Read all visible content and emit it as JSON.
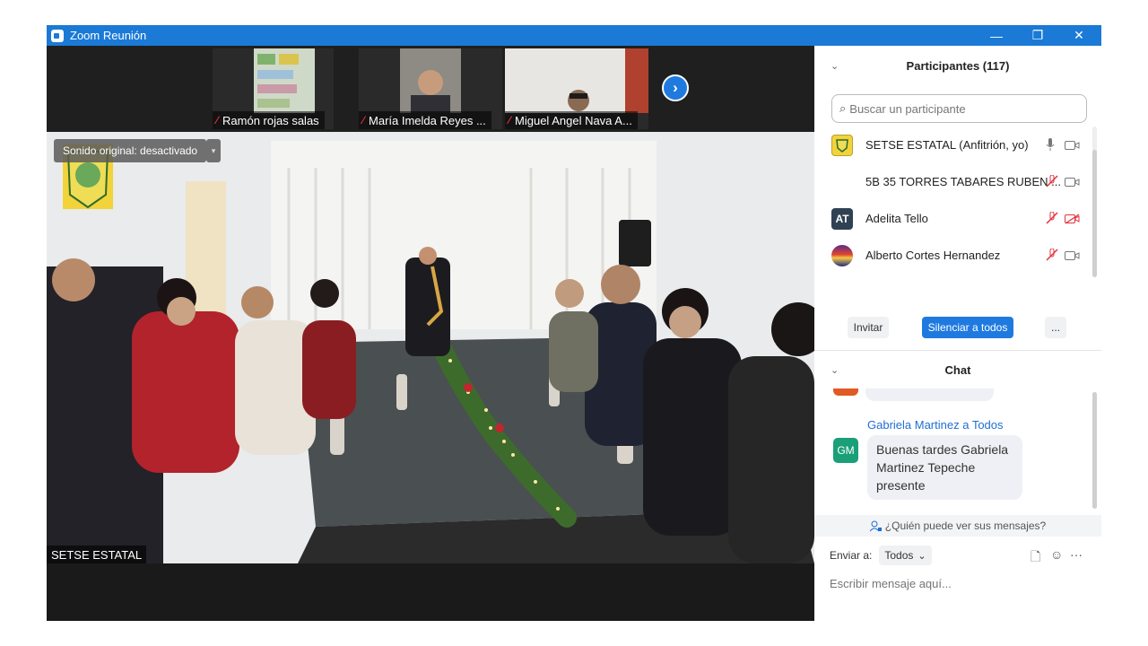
{
  "window": {
    "title": "Zoom Reunión",
    "minimize": "—",
    "restore": "❐",
    "close": "✕"
  },
  "strip": {
    "thumbs": [
      {
        "name": "Ramón rojas salas"
      },
      {
        "name": "María Imelda Reyes ..."
      },
      {
        "name": "Miguel Angel Nava A..."
      }
    ],
    "next": "›"
  },
  "main_video": {
    "sound_label": "Sonido original: desactivado",
    "sound_arrow": "▾",
    "speaker": "SETSE ESTATAL"
  },
  "participants": {
    "title": "Participantes (117)",
    "collapse": "⌄",
    "search_placeholder": "Buscar un participante",
    "rows": [
      {
        "name": "SETSE ESTATAL (Anfitrión, yo)",
        "avatar": "",
        "mic": "on",
        "cam": "on"
      },
      {
        "name": "5B 35 TORRES TABARES RUBEN ...",
        "avatar": "",
        "mic": "off",
        "cam": "on"
      },
      {
        "name": "Adelita Tello",
        "avatar": "AT",
        "mic": "off",
        "cam": "off"
      },
      {
        "name": "Alberto Cortes Hernandez",
        "avatar": "",
        "mic": "off",
        "cam": "on"
      }
    ],
    "buttons": {
      "invite": "Invitar",
      "mute_all": "Silenciar a todos",
      "more": "..."
    }
  },
  "chat": {
    "title": "Chat",
    "collapse": "⌄",
    "sender": "Gabriela Martinez a Todos",
    "avatar": "GM",
    "message": "Buenas tardes Gabriela Martinez Tepeche presente",
    "who_sees": "¿Quién puede ver sus mensajes?",
    "send_to_label": "Enviar a:",
    "send_to_value": "Todos",
    "send_to_caret": "⌄",
    "input_placeholder": "Escribir mensaje aquí...",
    "tools": {
      "file": "🗋",
      "emoji": "☺",
      "more": "···"
    }
  },
  "colors": {
    "accent": "#1a7ad6",
    "muted_red": "#e0323b",
    "mute_all_bg": "#1f7ae0",
    "gm_avatar": "#1a9f79"
  }
}
